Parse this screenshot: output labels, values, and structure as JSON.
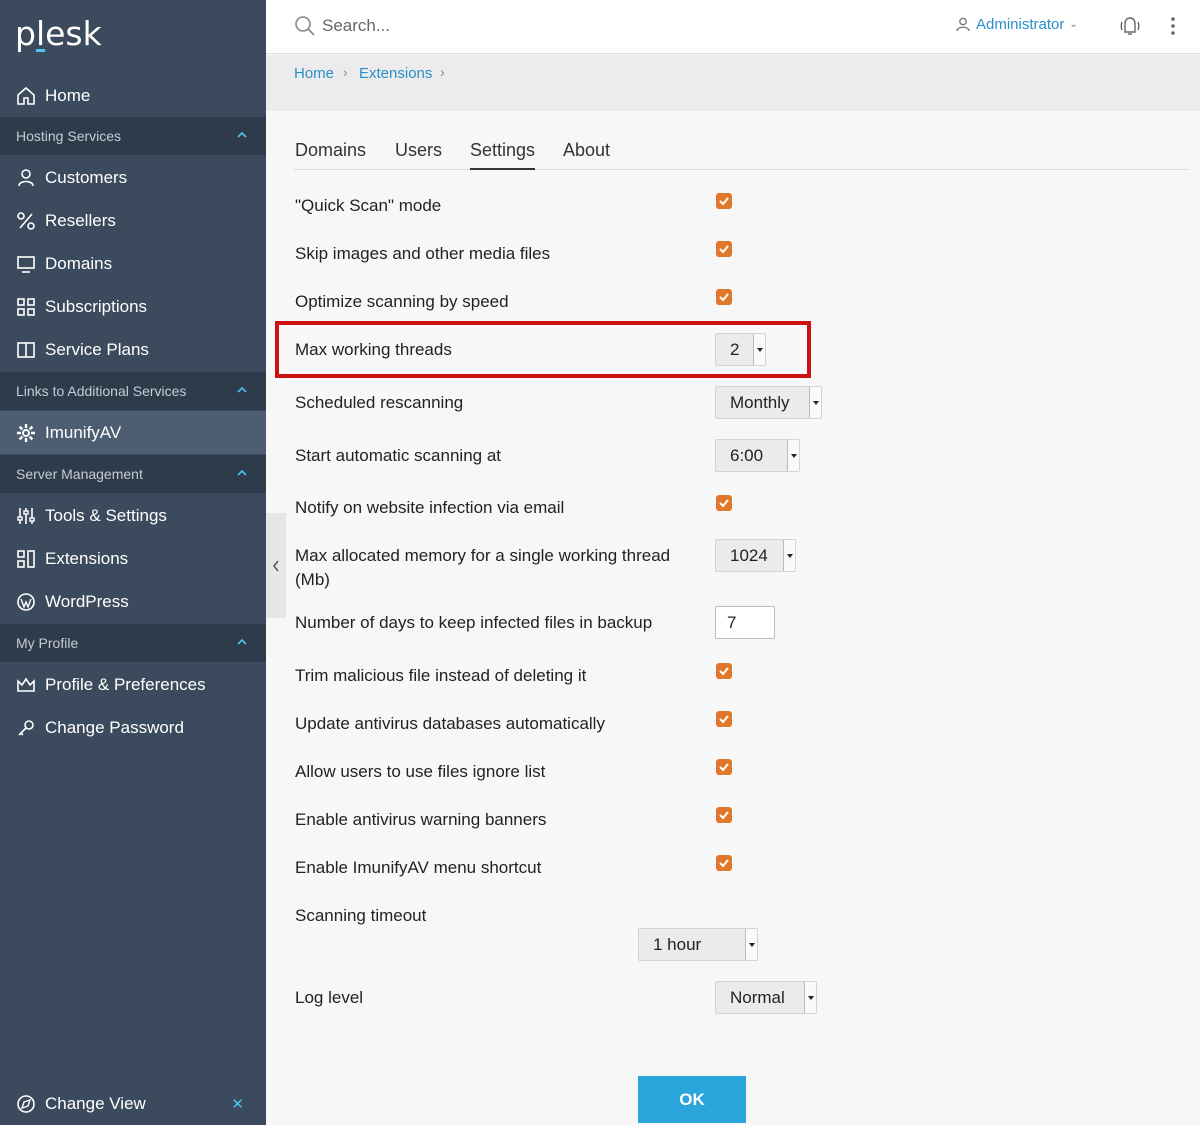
{
  "app": {
    "logo": "plesk"
  },
  "sidebar": {
    "home": "Home",
    "groups": {
      "hosting": "Hosting Services",
      "links": "Links to Additional Services",
      "server": "Server Management",
      "profile": "My Profile"
    },
    "items": {
      "customers": "Customers",
      "resellers": "Resellers",
      "domains": "Domains",
      "subscriptions": "Subscriptions",
      "service_plans": "Service Plans",
      "imunifyav": "ImunifyAV",
      "tools": "Tools & Settings",
      "extensions": "Extensions",
      "wordpress": "WordPress",
      "profile_prefs": "Profile & Preferences",
      "change_password": "Change Password"
    },
    "change_view": "Change View",
    "collapse_icon": "chevron-left-icon"
  },
  "topbar": {
    "search_placeholder": "Search...",
    "user": "Administrator"
  },
  "breadcrumb": {
    "home": "Home",
    "extensions": "Extensions"
  },
  "tabs": [
    "Domains",
    "Users",
    "Settings",
    "About"
  ],
  "active_tab": "Settings",
  "settings": {
    "quick_scan": "\"Quick Scan\" mode",
    "skip_media": "Skip images and other media files",
    "optimize_speed": "Optimize scanning by speed",
    "max_threads": "Max working threads",
    "max_threads_value": "2",
    "scheduled": "Scheduled rescanning",
    "scheduled_value": "Monthly",
    "start_at": "Start automatic scanning at",
    "start_at_value": "6:00",
    "notify_email": "Notify on website infection via email",
    "max_memory": "Max allocated memory for a single working thread (Mb)",
    "max_memory_value": "1024",
    "days_backup": "Number of days to keep infected files in backup",
    "days_backup_value": "7",
    "trim_malicious": "Trim malicious file instead of deleting it",
    "update_db": "Update antivirus databases automatically",
    "ignore_list": "Allow users to use files ignore list",
    "warning_banners": "Enable antivirus warning banners",
    "menu_shortcut": "Enable ImunifyAV menu shortcut",
    "scan_timeout": "Scanning timeout",
    "scan_timeout_value": "1 hour",
    "log_level": "Log level",
    "log_level_value": "Normal"
  },
  "ok_button": "OK",
  "colors": {
    "sidebar": "#3b4a5c",
    "accent": "#29a5dc",
    "checkbox": "#e0772b",
    "highlight": "#cc1111"
  }
}
